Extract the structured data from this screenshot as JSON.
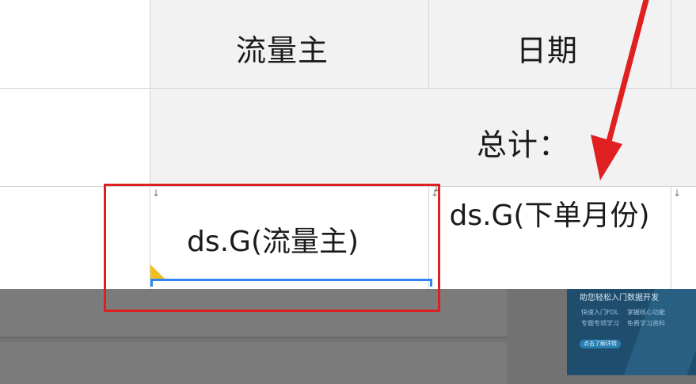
{
  "sheet": {
    "headers": [
      "流量主",
      "日期"
    ],
    "total_label": "总计：",
    "cell_ds_liuliangzhu": "ds.G(流量主)",
    "cell_ds_xiadanyuefen": "ds.G(下单月份)",
    "cell_corner_marks": [
      "↓",
      "↓",
      "↓",
      "↓"
    ]
  },
  "ad": {
    "title": "助您轻松入门数据开发",
    "lines": [
      "快速入门FDL",
      "掌握核心功能",
      "专题专项学习",
      "免费学习资料"
    ],
    "button": "点击了解详情"
  },
  "colors": {
    "header_bg": "#f2f2f2",
    "grid": "#d4d4d4",
    "highlight_red": "#e02020",
    "selection_blue": "#2f86f0",
    "overlay_gray": "#727272"
  }
}
